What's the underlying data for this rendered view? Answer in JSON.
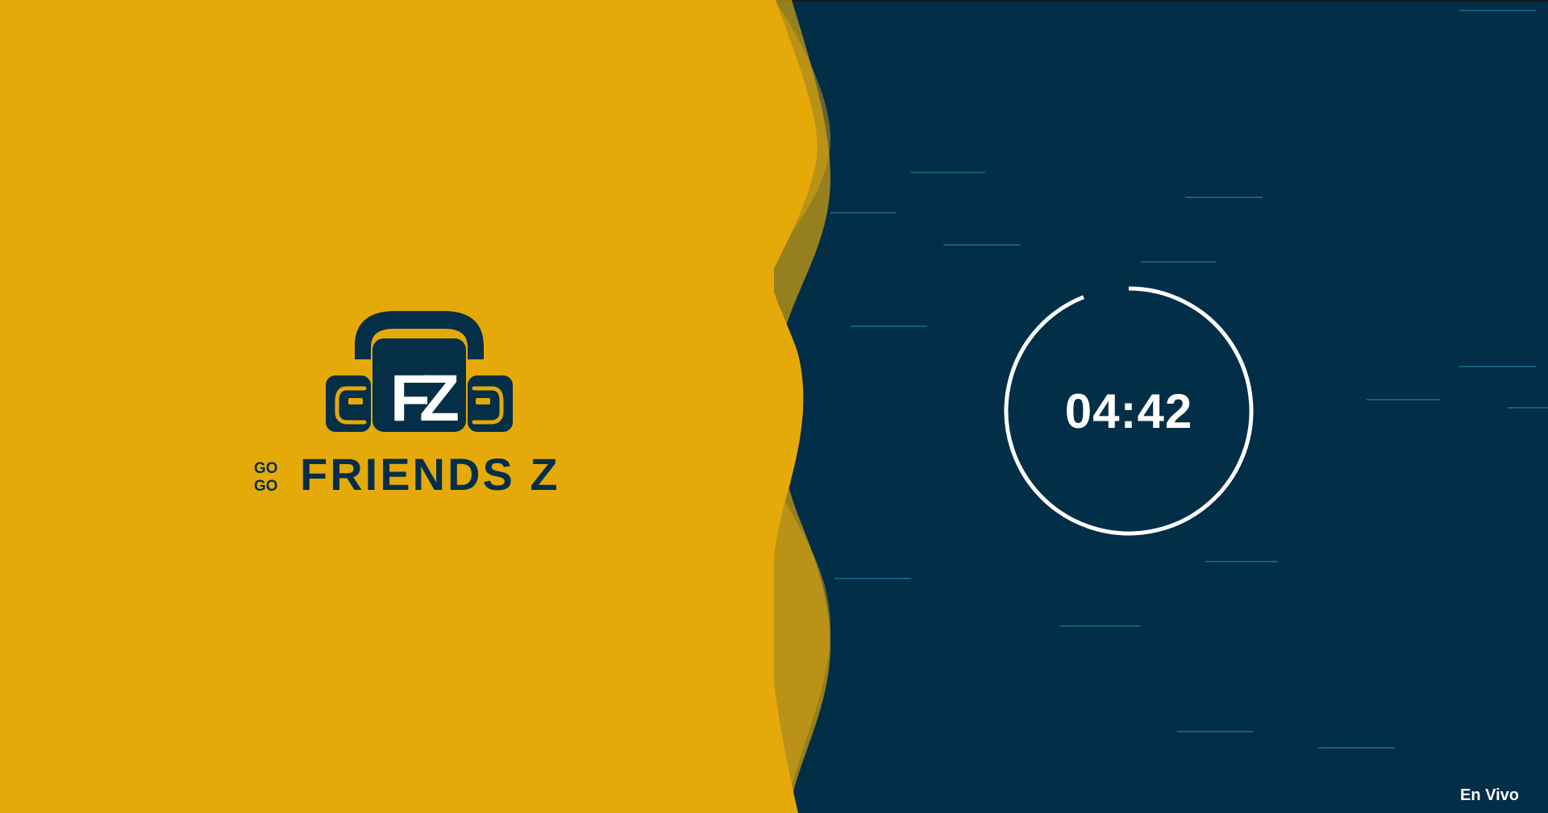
{
  "screen": {
    "title": "Go Go Friends Z countdown"
  },
  "logo": {
    "monogram": "FZ",
    "prefix_top": "GO",
    "prefix_bottom": "GO",
    "brand_name": "FRIENDS Z"
  },
  "timer": {
    "display": "04:42",
    "progress_fraction": 0.94
  },
  "status": {
    "label": "En Vivo"
  },
  "colors": {
    "left_panel": "#e5aa09",
    "right_panel": "#032e47",
    "wave_overlay": "#8a7a2a",
    "ring": "#ffffff",
    "text": "#ffffff",
    "streak": "#1a6a8f"
  }
}
